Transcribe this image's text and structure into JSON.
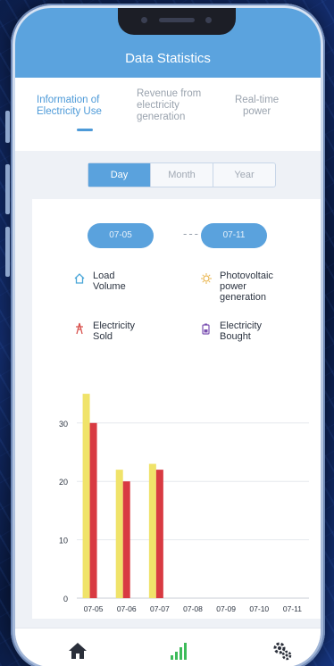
{
  "header": {
    "title": "Data Statistics"
  },
  "tabs": [
    {
      "label_lines": [
        "Information of",
        "Electricity Use"
      ],
      "active": true
    },
    {
      "label_lines": [
        "Revenue from",
        "electricity",
        "generation"
      ],
      "active": false
    },
    {
      "label_lines": [
        "Real-time",
        "power"
      ],
      "active": false
    }
  ],
  "period": {
    "options": [
      "Day",
      "Month",
      "Year"
    ],
    "selected": "Day"
  },
  "date_range": {
    "start": "07-05",
    "separator": "---",
    "end": "07-11"
  },
  "legend": [
    {
      "icon": "house-icon",
      "lines": [
        "Load",
        "Volume"
      ],
      "color": "#4aa6d8"
    },
    {
      "icon": "sun-icon",
      "lines": [
        "Photovoltaic",
        "power",
        "generation"
      ],
      "color": "#e9b44c"
    },
    {
      "icon": "tower-icon",
      "lines": [
        "Electricity",
        "Sold"
      ],
      "color": "#d9534f"
    },
    {
      "icon": "battery-icon",
      "lines": [
        "Electricity",
        "Bought"
      ],
      "color": "#7a4fb0"
    }
  ],
  "chart_data": {
    "type": "bar",
    "categories": [
      "07-05",
      "07-06",
      "07-07",
      "07-08",
      "07-09",
      "07-10",
      "07-11"
    ],
    "series": [
      {
        "color": "#f0e36a",
        "values": [
          35,
          22,
          23,
          0,
          0,
          0,
          0
        ]
      },
      {
        "color": "#d83a42",
        "values": [
          30,
          20,
          22,
          0,
          0,
          0,
          0
        ]
      }
    ],
    "yticks": [
      0,
      10,
      20,
      30
    ],
    "ylim": [
      0,
      37
    ],
    "grid": true
  },
  "bottom_nav": [
    {
      "icon": "home-icon",
      "active": false
    },
    {
      "icon": "signal-bars-icon",
      "active": true,
      "color": "#3dbb5a"
    },
    {
      "icon": "gear-icon",
      "active": false
    }
  ]
}
